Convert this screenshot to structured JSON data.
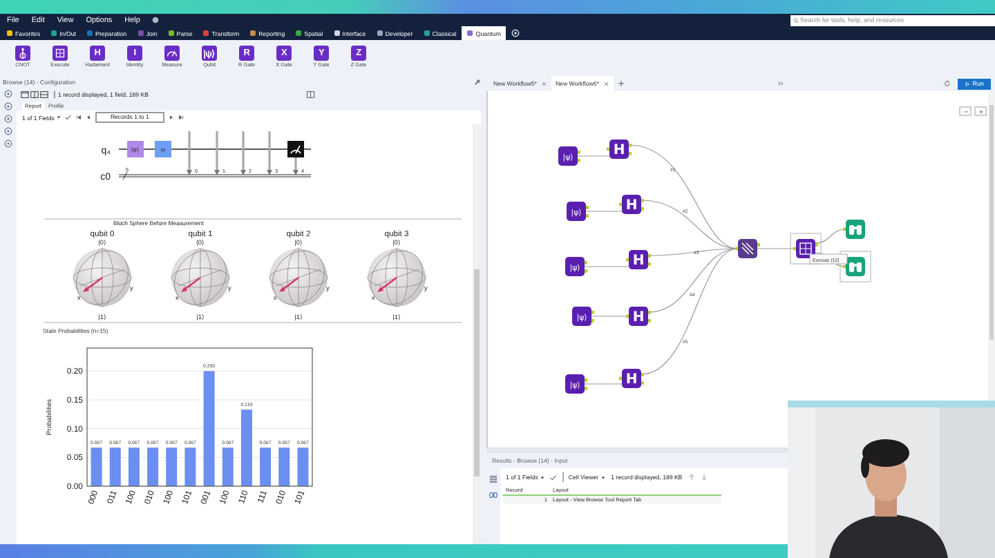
{
  "top_menu": [
    "File",
    "Edit",
    "View",
    "Options",
    "Help"
  ],
  "search": {
    "placeholder": "Search for tools, help, and resources"
  },
  "categories": [
    {
      "label": "Favorites",
      "color": "#f2c200",
      "selected": false
    },
    {
      "label": "In/Out",
      "color": "#1aa39a",
      "selected": false
    },
    {
      "label": "Preparation",
      "color": "#1f6fb8",
      "selected": false
    },
    {
      "label": "Join",
      "color": "#7b4fa8",
      "selected": false
    },
    {
      "label": "Parse",
      "color": "#7cb82f",
      "selected": false
    },
    {
      "label": "Transform",
      "color": "#d9453b",
      "selected": false
    },
    {
      "label": "Reporting",
      "color": "#c98a4b",
      "selected": false
    },
    {
      "label": "Spatial",
      "color": "#3aa845",
      "selected": false
    },
    {
      "label": "Interface",
      "color": "#d0d4dc",
      "selected": false
    },
    {
      "label": "Developer",
      "color": "#9aa3b5",
      "selected": false
    },
    {
      "label": "Classical",
      "color": "#1fa39a",
      "selected": false
    },
    {
      "label": "Quantum",
      "color": "#8e6cd6",
      "selected": true
    }
  ],
  "tools": [
    {
      "label": "CNOT",
      "kind": "cnot"
    },
    {
      "label": "Execute",
      "kind": "execute"
    },
    {
      "label": "Hadamard",
      "kind": "letter",
      "glyph": "H"
    },
    {
      "label": "Identity",
      "kind": "letter",
      "glyph": "I"
    },
    {
      "label": "Measure",
      "kind": "measure"
    },
    {
      "label": "Qubit",
      "kind": "letter",
      "glyph": "|ψ⟩"
    },
    {
      "label": "R Gate",
      "kind": "letter",
      "glyph": "R"
    },
    {
      "label": "X Gate",
      "kind": "letter",
      "glyph": "X"
    },
    {
      "label": "Y Gate",
      "kind": "letter",
      "glyph": "Y"
    },
    {
      "label": "Z Gate",
      "kind": "letter",
      "glyph": "Z"
    }
  ],
  "config": {
    "title": "Browse (14) - Configuration",
    "summary": "1 record displayed, 1 field, 189 KB",
    "tabs": [
      {
        "label": "Report",
        "selected": true
      },
      {
        "label": "Profile",
        "selected": false
      }
    ],
    "fields": "1 of 1 Fields",
    "records": "Records 1 to 1",
    "circuit": {
      "qubit_label": "q₄",
      "classical_label": "c0",
      "register_size": "5",
      "qubit_gate": "|ψ⟩",
      "h_gate": "H",
      "measure_indices": [
        "0",
        "1",
        "2",
        "3",
        "4"
      ]
    },
    "bloch_title": "Bloch Sphere Before Measurement",
    "spheres": [
      {
        "label": "qubit 0",
        "top": "|0⟩",
        "bottom": "|1⟩",
        "x": "x",
        "y": "y"
      },
      {
        "label": "qubit 1",
        "top": "|0⟩",
        "bottom": "|1⟩",
        "x": "x",
        "y": "y"
      },
      {
        "label": "qubit 2",
        "top": "|0⟩",
        "bottom": "|1⟩",
        "x": "x",
        "y": "y"
      },
      {
        "label": "qubit 3",
        "top": "|0⟩",
        "bottom": "|1⟩",
        "x": "x",
        "y": "y"
      }
    ],
    "chart_data": {
      "type": "bar",
      "title": "State Probabilities (n=15)",
      "ylabel": "Probabilities",
      "categories": [
        "000",
        "011",
        "100",
        "010",
        "100",
        "101",
        "001",
        "100",
        "110",
        "111",
        "010",
        "101"
      ],
      "values": [
        0.067,
        0.067,
        0.067,
        0.067,
        0.067,
        0.067,
        0.2,
        0.067,
        0.133,
        0.067,
        0.067,
        0.067
      ],
      "ylim": [
        0,
        0.24
      ],
      "yticks": [
        {
          "value": 0,
          "label": "0.00"
        },
        {
          "value": 0.05,
          "label": "0.05"
        },
        {
          "value": 0.1,
          "label": "0.10"
        },
        {
          "value": 0.15,
          "label": "0.15"
        },
        {
          "value": 0.2,
          "label": "0.20"
        }
      ],
      "grid": true,
      "value_labels": [
        "0.067",
        "0.067",
        "0.067",
        "0.067",
        "0.067",
        "0.067",
        "0.200",
        "0.067",
        "0.133",
        "0.067",
        "0.067",
        "0.067"
      ]
    }
  },
  "workflow": {
    "tabs": [
      {
        "label": "New Workflow5*",
        "selected": false
      },
      {
        "label": "New Workflow6*",
        "selected": true
      }
    ],
    "run": "Run",
    "nodes": [
      {
        "kind": "qubit",
        "glyph": "|ψ⟩",
        "selected": false
      },
      {
        "kind": "hadamard",
        "glyph": "H",
        "selected": false
      },
      {
        "kind": "qubit",
        "glyph": "|ψ⟩",
        "selected": false
      },
      {
        "kind": "hadamard",
        "glyph": "H",
        "selected": false
      },
      {
        "kind": "qubit",
        "glyph": "|ψ⟩",
        "selected": false
      },
      {
        "kind": "hadamard",
        "glyph": "H",
        "selected": false
      },
      {
        "kind": "qubit",
        "glyph": "|ψ⟩",
        "selected": false
      },
      {
        "kind": "hadamard",
        "glyph": "H",
        "selected": false
      },
      {
        "kind": "qubit",
        "glyph": "|ψ⟩",
        "selected": false
      },
      {
        "kind": "hadamard",
        "glyph": "H",
        "selected": false
      },
      {
        "kind": "union",
        "selected": false
      },
      {
        "kind": "execute",
        "selected": true
      },
      {
        "kind": "browse",
        "selected": false
      },
      {
        "kind": "browse",
        "selected": true
      }
    ],
    "edge_labels": [
      "#1",
      "#2",
      "#3",
      "#4",
      "#5"
    ],
    "tooltip": "Execute (12)"
  },
  "results": {
    "title": "Results - Browse (14) - Input",
    "fields": "1 of 1 Fields",
    "viewer": "Cell Viewer",
    "summary": "1 record displayed, 189 KB",
    "columns": [
      "Record",
      "Layout"
    ],
    "rows": [
      [
        "1",
        "Layout - View Browse Tool Report Tab"
      ]
    ]
  }
}
